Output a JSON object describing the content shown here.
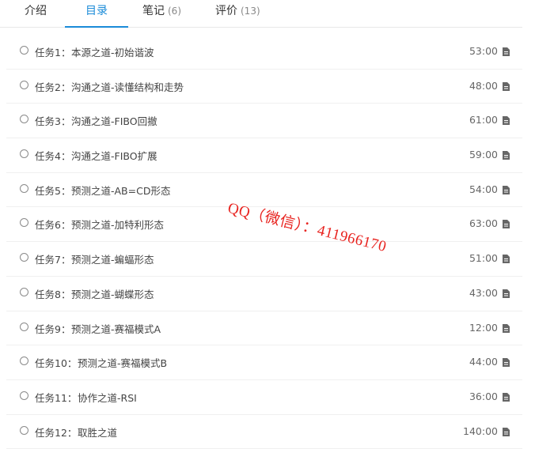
{
  "tabs": [
    {
      "label": "介绍",
      "count": ""
    },
    {
      "label": "目录",
      "count": ""
    },
    {
      "label": "笔记",
      "count": "(6)"
    },
    {
      "label": "评价",
      "count": "(13)"
    }
  ],
  "active_tab": "目录",
  "tasks": [
    {
      "label": "任务1：",
      "title": "本源之道-初始谐波",
      "duration": "53:00"
    },
    {
      "label": "任务2：",
      "title": "沟通之道-读懂结构和走势",
      "duration": "48:00"
    },
    {
      "label": "任务3：",
      "title": "沟通之道-FIBO回撤",
      "duration": "61:00"
    },
    {
      "label": "任务4：",
      "title": "沟通之道-FIBO扩展",
      "duration": "59:00"
    },
    {
      "label": "任务5：",
      "title": "预测之道-AB=CD形态",
      "duration": "54:00"
    },
    {
      "label": "任务6：",
      "title": "预测之道-加特利形态",
      "duration": "63:00"
    },
    {
      "label": "任务7：",
      "title": "预测之道-蝙蝠形态",
      "duration": "51:00"
    },
    {
      "label": "任务8：",
      "title": "预测之道-蝴蝶形态",
      "duration": "43:00"
    },
    {
      "label": "任务9：",
      "title": "预测之道-赛福模式A",
      "duration": "12:00"
    },
    {
      "label": "任务10：",
      "title": "预测之道-赛福模式B",
      "duration": "44:00"
    },
    {
      "label": "任务11：",
      "title": "协作之道-RSI",
      "duration": "36:00"
    },
    {
      "label": "任务12：",
      "title": "取胜之道",
      "duration": "140:00"
    }
  ],
  "icons": {
    "task_status": "circle-outline-icon",
    "file": "document-icon"
  },
  "colors": {
    "accent": "#1a8bd8",
    "watermark": "#e8231f"
  },
  "watermark": {
    "text": "QQ（微信）：411966170"
  }
}
